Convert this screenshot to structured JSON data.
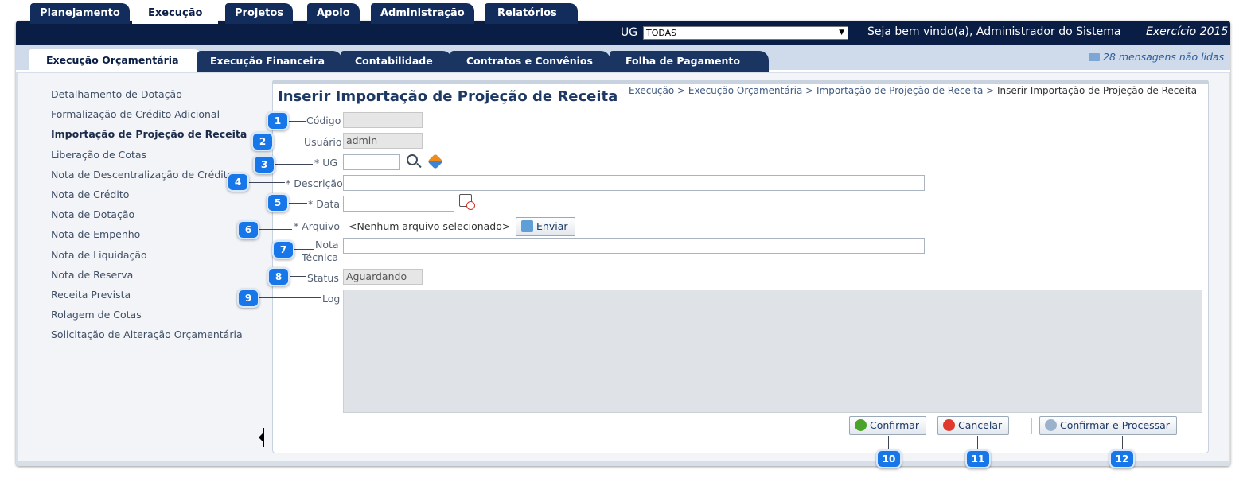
{
  "top_nav": {
    "tabs": [
      "Planejamento",
      "Execução",
      "Projetos",
      "Apoio",
      "Administração",
      "Relatórios"
    ],
    "active": "Execução"
  },
  "ug_selector": {
    "label": "UG",
    "value": "TODAS"
  },
  "welcome": "Seja bem vindo(a), Administrador do Sistema",
  "exercicio": "Exercício 2015",
  "sub_nav": {
    "tabs": [
      "Execução Orçamentária",
      "Execução Financeira",
      "Contabilidade",
      "Contratos e Convênios",
      "Folha de Pagamento"
    ],
    "active": "Execução Orçamentária"
  },
  "messages": "28 mensagens não lidas",
  "sidebar": {
    "items": [
      "Detalhamento de Dotação",
      "Formalização de Crédito Adicional",
      "Importação de Projeção de Receita",
      "Liberação de Cotas",
      "Nota de Descentralização de Crédito",
      "Nota de Crédito",
      "Nota de Dotação",
      "Nota de Empenho",
      "Nota de Liquidação",
      "Nota de Reserva",
      "Receita Prevista",
      "Rolagem de Cotas",
      "Solicitação de Alteração Orçamentária"
    ],
    "active_index": 2
  },
  "page": {
    "title": "Inserir Importação de Projeção de Receita",
    "breadcrumb": "Execução > Execução Orçamentária > Importação de Projeção de Receita > ",
    "breadcrumb_last": "Inserir Importação de Projeção de Receita"
  },
  "form": {
    "codigo": {
      "label": "Código",
      "value": ""
    },
    "usuario": {
      "label": "Usuário",
      "value": "admin"
    },
    "ug": {
      "label": "* UG",
      "value": ""
    },
    "descricao": {
      "label": "* Descrição",
      "value": ""
    },
    "data": {
      "label": "* Data",
      "value": ""
    },
    "arquivo": {
      "label": "* Arquivo",
      "value": "<Nenhum arquivo selecionado>",
      "button": "Enviar"
    },
    "nota_tecnica": {
      "label_line1": "Nota",
      "label_line2": "Técnica",
      "value": ""
    },
    "status": {
      "label": "Status",
      "value": "Aguardando"
    },
    "log": {
      "label": "Log",
      "value": ""
    }
  },
  "buttons": {
    "confirmar": "Confirmar",
    "cancelar": "Cancelar",
    "confirmar_processar": "Confirmar e Processar"
  },
  "callouts": [
    "1",
    "2",
    "3",
    "4",
    "5",
    "6",
    "7",
    "8",
    "9",
    "10",
    "11",
    "12"
  ],
  "colors": {
    "nav_dark": "#0a1e45",
    "accent_blue": "#1877e8",
    "title_blue": "#1e3a64"
  }
}
